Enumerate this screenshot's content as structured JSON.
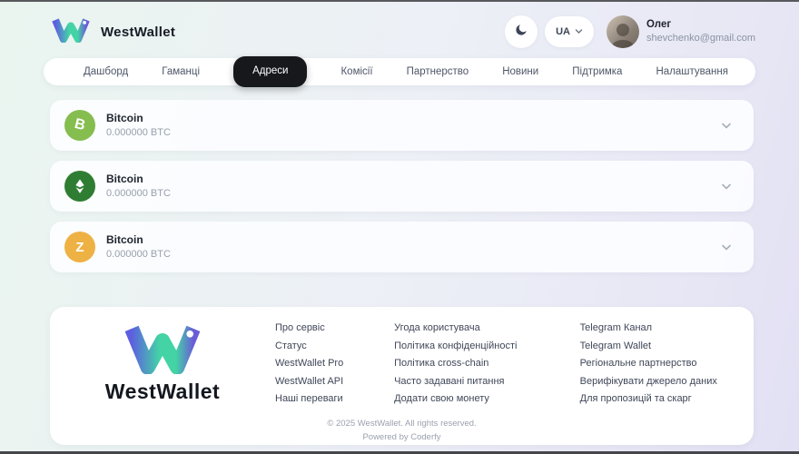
{
  "header": {
    "brand": "WestWallet",
    "language": "UA",
    "user": {
      "name": "Олег",
      "email": "shevchenko@gmail.com"
    }
  },
  "nav": {
    "tabs": [
      {
        "label": "Дашборд",
        "active": false
      },
      {
        "label": "Гаманці",
        "active": false
      },
      {
        "label": "Адреси",
        "active": true
      },
      {
        "label": "Комісії",
        "active": false
      },
      {
        "label": "Партнерство",
        "active": false
      },
      {
        "label": "Новини",
        "active": false
      },
      {
        "label": "Підтримка",
        "active": false
      },
      {
        "label": "Налаштування",
        "active": false
      }
    ]
  },
  "wallets": [
    {
      "name": "Bitcoin",
      "balance": "0.000000 BTC",
      "icon": "bitcoin-icon",
      "icon_color": "#85bd4f"
    },
    {
      "name": "Bitcoin",
      "balance": "0.000000 BTC",
      "icon": "ethereum-classic-icon",
      "icon_color": "#2e7d33"
    },
    {
      "name": "Bitcoin",
      "balance": "0.000000 BTC",
      "icon": "zcash-icon",
      "icon_color": "#eeb144"
    }
  ],
  "footer": {
    "brand": "WestWallet",
    "columns": [
      {
        "links": [
          "Про сервіс",
          "Статус",
          "WestWallet Pro",
          "WestWallet API",
          "Наші переваги"
        ]
      },
      {
        "links": [
          "Угода користувача",
          "Політика конфіденційності",
          "Політика cross-chain",
          "Часто задавані питання",
          "Додати свою монету"
        ]
      },
      {
        "links": [
          "Telegram Канал",
          "Telegram Wallet",
          "Регіональне партнерство",
          "Верифікувати джерело даних",
          "Для пропозицій та скарг"
        ]
      }
    ],
    "copyright": "© 2025 WestWallet. All rights reserved.",
    "powered": "Powered by Coderfy"
  },
  "colors": {
    "active_tab_bg": "#17181c",
    "logo_gradient_start": "#5d5fe0",
    "logo_gradient_mid": "#43d3a5",
    "logo_gradient_end": "#6a5cd8"
  }
}
